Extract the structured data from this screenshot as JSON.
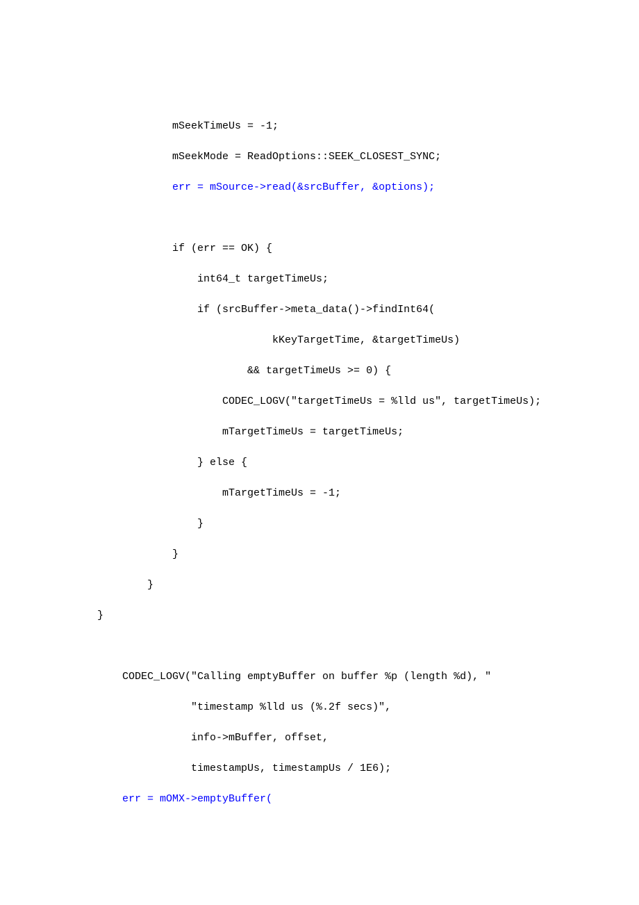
{
  "code": {
    "l1": "            mSeekTimeUs = -1;",
    "l2": "            mSeekMode = ReadOptions::SEEK_CLOSEST_SYNC;",
    "l3a": "            ",
    "l3b": "err = mSource->read(&srcBuffer, &options);",
    "l4": "",
    "l5": "            if (err == OK) {",
    "l6": "                int64_t targetTimeUs;",
    "l7": "                if (srcBuffer->meta_data()->findInt64(",
    "l8": "                            kKeyTargetTime, &targetTimeUs)",
    "l9": "                        && targetTimeUs >= 0) {",
    "l10": "                    CODEC_LOGV(\"targetTimeUs = %lld us\", targetTimeUs);",
    "l11": "                    mTargetTimeUs = targetTimeUs;",
    "l12": "                } else {",
    "l13": "                    mTargetTimeUs = -1;",
    "l14": "                }",
    "l15": "            }",
    "l16": "        }",
    "l17": "}",
    "l18": "",
    "l19": "    CODEC_LOGV(\"Calling emptyBuffer on buffer %p (length %d), \"",
    "l20": "               \"timestamp %lld us (%.2f secs)\",",
    "l21": "               info->mBuffer, offset,",
    "l22": "               timestampUs, timestampUs / 1E6);",
    "l23a": "    ",
    "l23b": "err = mOMX->emptyBuffer("
  }
}
